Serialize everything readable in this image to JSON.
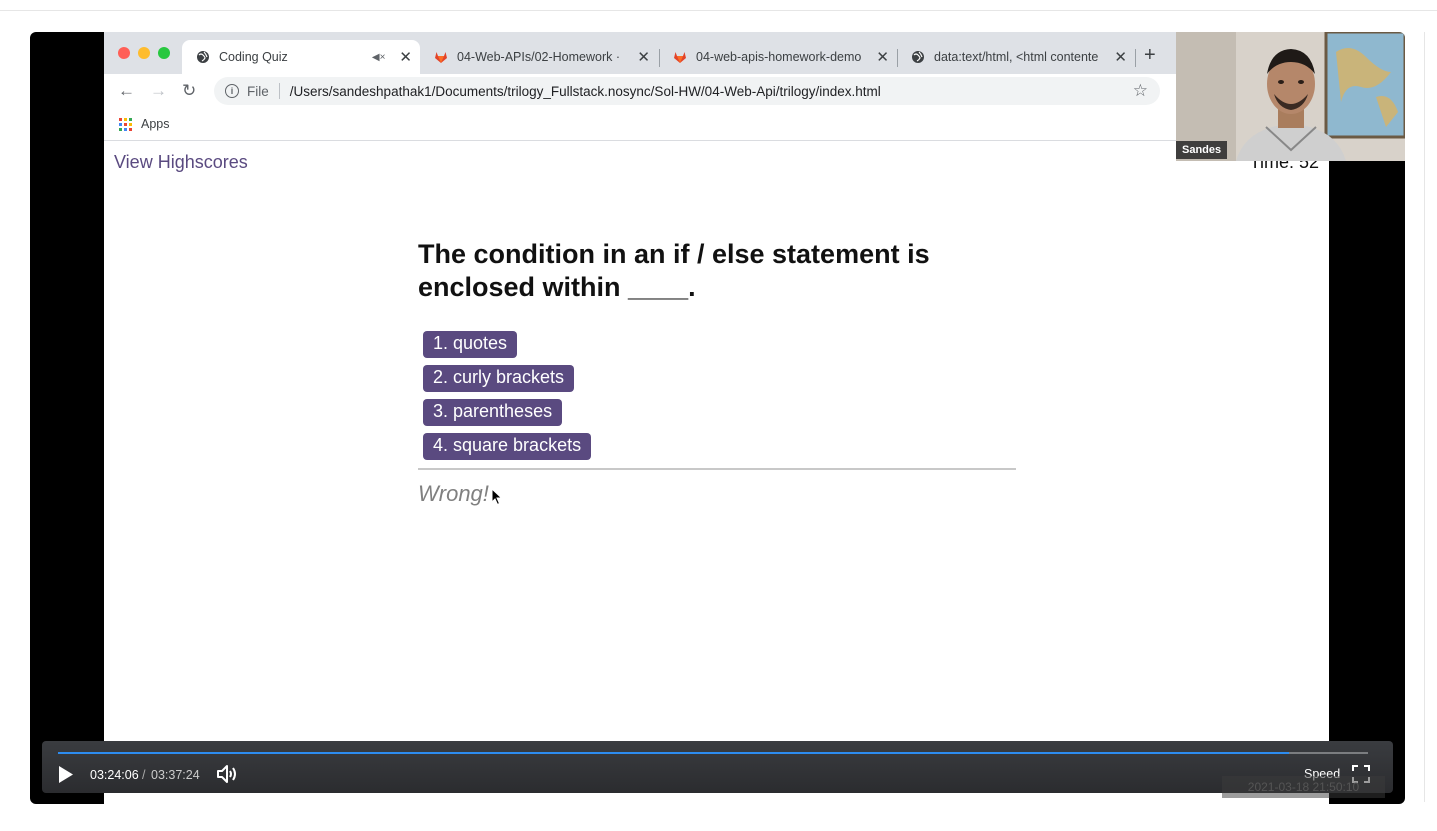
{
  "browser": {
    "tabs": [
      {
        "title": "Coding Quiz",
        "active": true,
        "muted": true
      },
      {
        "title": "04-Web-APIs/02-Homework ·",
        "active": false
      },
      {
        "title": "04-web-apis-homework-demo",
        "active": false
      },
      {
        "title": "data:text/html, <html contente",
        "active": false
      }
    ],
    "new_tab_label": "+",
    "address": {
      "scheme_label": "File",
      "url": "/Users/sandeshpathak1/Documents/trilogy_Fullstack.nosync/Sol-HW/04-Web-Api/trilogy/index.html"
    },
    "bookmarks": {
      "apps_label": "Apps"
    }
  },
  "page": {
    "highscores_link": "View Highscores",
    "timer_text": "Time: 52",
    "question": "The condition in an if / else statement is enclosed within ____.",
    "choices": [
      "1. quotes",
      "2. curly brackets",
      "3. parentheses",
      "4. square brackets"
    ],
    "feedback": "Wrong!"
  },
  "webcam": {
    "name": "Sandes"
  },
  "player": {
    "current_time": "03:24:06",
    "separator": "/",
    "total_time": "03:37:24",
    "progress": 0.94,
    "speed_label": "Speed",
    "watermark": "2021-03-18 21:50:10"
  },
  "colors": {
    "accent": "#5a4a80",
    "progress": "#2d8cf0"
  }
}
